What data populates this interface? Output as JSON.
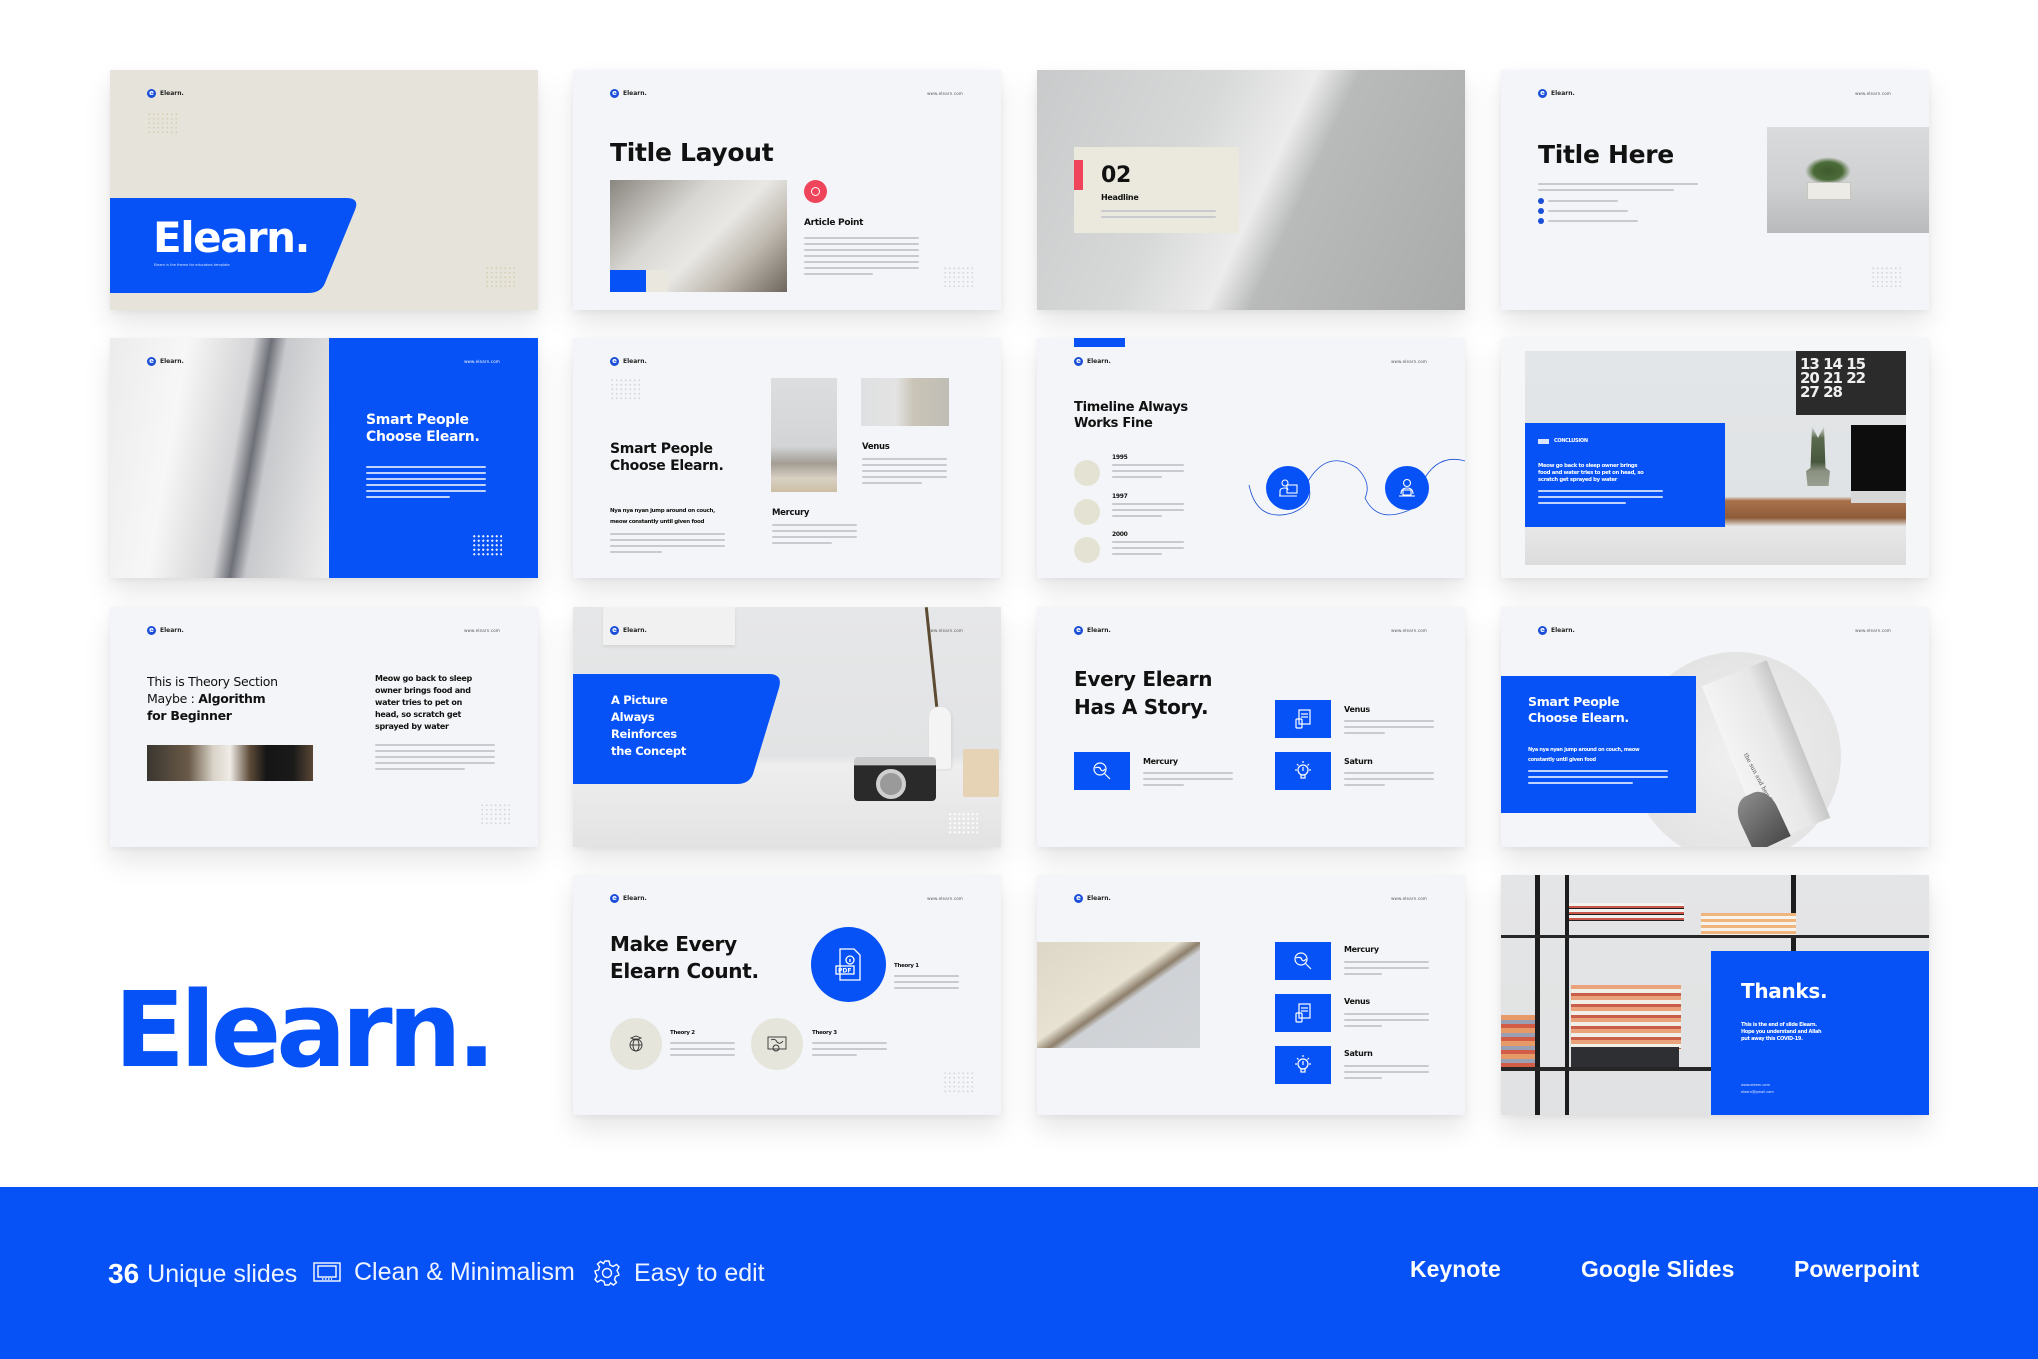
{
  "brand": {
    "name": "Elearn.",
    "logo_letter": "e",
    "url": "www.elearn.com",
    "accent_color": "#0652f6",
    "coral_color": "#f0445a",
    "beige_color": "#e6e4da"
  },
  "slides": {
    "cover": {
      "title": "Elearn.",
      "subtitle": "Elearn is the theme for educators template"
    },
    "title_layout": {
      "title": "Title Layout",
      "point_title": "Article Point",
      "icon": "book-circle-icon"
    },
    "section": {
      "number": "02",
      "headline": "Headline"
    },
    "title_here": {
      "title": "Title Here",
      "bullets": [
        "bullet-1",
        "bullet-2",
        "bullet-3"
      ]
    },
    "smart_split": {
      "title_line1": "Smart People",
      "title_line2": "Choose Elearn."
    },
    "smart_gallery": {
      "title_line1": "Smart People",
      "title_line2": "Choose Elearn.",
      "sub_line1": "Nya nya nyan jump around on couch,",
      "sub_line2": "meow constantly until given food",
      "item1": "Mercury",
      "item2": "Venus"
    },
    "timeline": {
      "title_line1": "Timeline Always",
      "title_line2": "Works Fine",
      "years": [
        "1995",
        "1997",
        "2000"
      ]
    },
    "conclusion": {
      "label": "CONCLUSION",
      "text_line1": "Meow go back to sleep owner brings",
      "text_line2": "food and water tries to pet on head, so",
      "text_line3": "scratch get sprayed by water",
      "calendar": [
        "13 14 15",
        "20 21 22",
        "27 28"
      ]
    },
    "theory": {
      "line1": "This is Theory Section",
      "line2_light": "Maybe : ",
      "line2_bold": "Algorithm",
      "line3": "for Beginner",
      "quote_line1": "Meow go back to sleep",
      "quote_line2": "owner brings food and",
      "quote_line3": "water tries to pet on",
      "quote_line4": "head, so scratch get",
      "quote_line5": "sprayed by water"
    },
    "picture": {
      "line1": "A Picture",
      "line2": "Always",
      "line3": "Reinforces",
      "line4": "the Concept"
    },
    "story": {
      "title_line1": "Every Elearn",
      "title_line2": "Has A Story.",
      "items": [
        "Mercury",
        "Venus",
        "Saturn"
      ]
    },
    "smart_card": {
      "title_line1": "Smart People",
      "title_line2": "Choose Elearn.",
      "sub_line1": "Nya nya nyan jump around on couch, meow",
      "sub_line2": "constantly until given food",
      "book_text": "the sun and her flowers"
    },
    "count": {
      "title_line1": "Make Every",
      "title_line2": "Elearn Count.",
      "theories": [
        "Theory 1",
        "Theory 2",
        "Theory 3"
      ],
      "pdf_label": "PDF"
    },
    "list_icons": {
      "items": [
        "Mercury",
        "Venus",
        "Saturn"
      ]
    },
    "thanks": {
      "title": "Thanks.",
      "line1": "This is the end of slide Elearn.",
      "line2": "Hope you understand and Allah",
      "line3": "put away this COVID-19.",
      "contact1": "www.elearn.com",
      "contact2": "elearn@gmail.com"
    }
  },
  "hero_logo": "Elearn.",
  "features": {
    "count": "36",
    "count_label": "Unique slides",
    "clean": "Clean & Minimalism",
    "edit": "Easy to edit"
  },
  "platforms": [
    "Keynote",
    "Google Slides",
    "Powerpoint"
  ]
}
